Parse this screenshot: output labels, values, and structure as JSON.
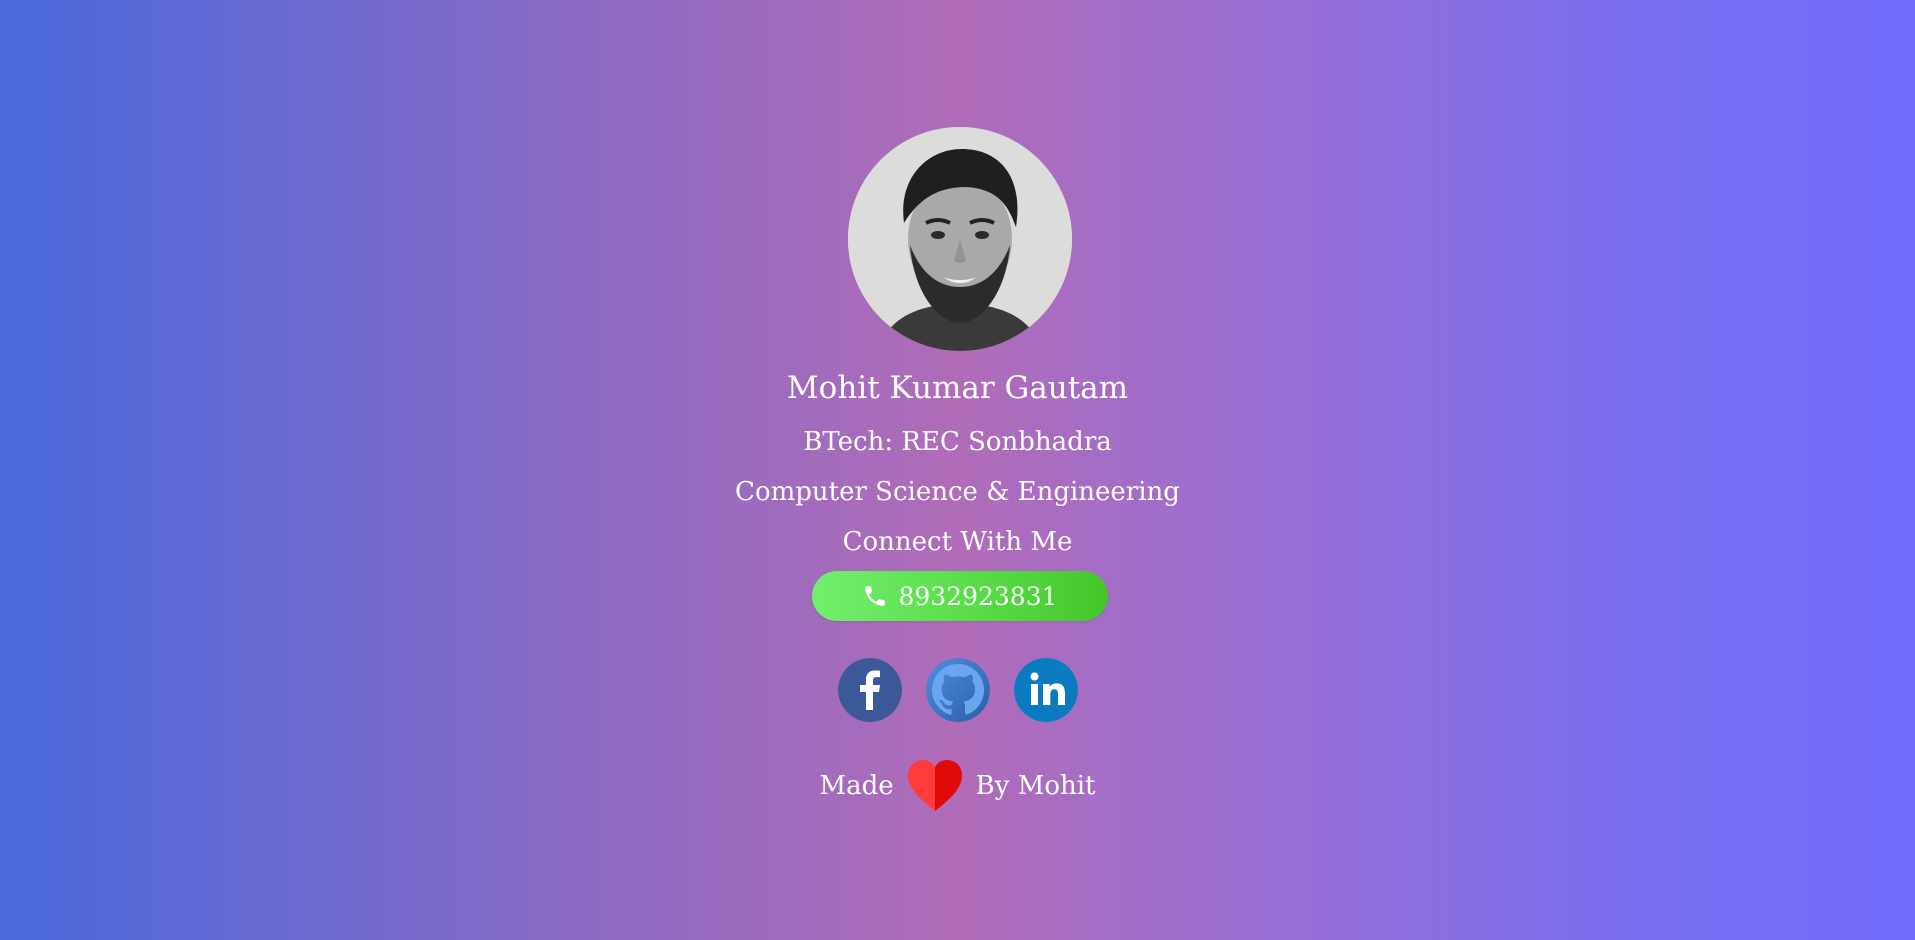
{
  "profile": {
    "name": "Mohit Kumar Gautam",
    "education": "BTech: REC Sonbhadra",
    "branch": "Computer Science & Engineering",
    "connect_heading": "Connect With Me",
    "avatar_icon": "profile-photo"
  },
  "contact": {
    "phone": "8932923831",
    "phone_icon": "phone-icon"
  },
  "social": [
    {
      "name": "facebook",
      "icon": "facebook-icon",
      "color": "#3b5998"
    },
    {
      "name": "github",
      "icon": "github-icon",
      "color": "#4078c0"
    },
    {
      "name": "linkedin",
      "icon": "linkedin-icon",
      "color": "#0a7bc1"
    }
  ],
  "footer": {
    "made": "Made",
    "by": "By Mohit",
    "heart_icon": "heart-icon",
    "heart_color": "#ff1f1f"
  },
  "colors": {
    "gradient_left": "#4a69dd",
    "gradient_mid": "#b06cb8",
    "gradient_right": "#706cfb",
    "button_green": "#59dc48"
  }
}
